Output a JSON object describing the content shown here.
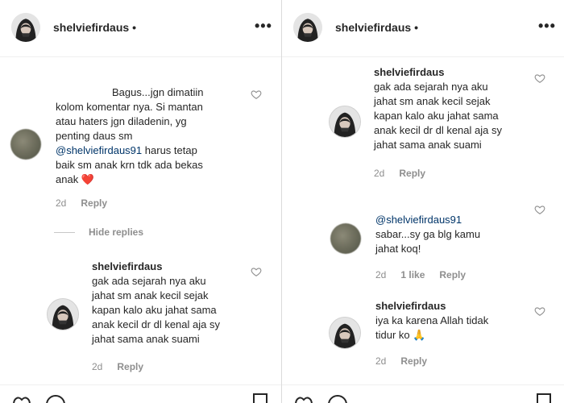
{
  "left": {
    "header": {
      "username": "shelviefirdaus",
      "separator": "•",
      "more": "•••"
    },
    "comment": {
      "lines": [
        "Bagus...jgn dimatiin",
        "kolom komentar nya. Si mantan",
        "atau haters jgn diladenin, yg",
        "penting daus sm",
        "harus tetap",
        "baik sm anak krn tdk ada bekas",
        "anak"
      ],
      "mention": "@shelviefirdaus91",
      "emoji": "❤️",
      "time": "2d",
      "reply": "Reply"
    },
    "hide_replies": "Hide replies",
    "reply_comment": {
      "username": "shelviefirdaus",
      "lines": [
        "gak ada sejarah nya aku",
        "jahat sm anak kecil sejak",
        "kapan kalo aku jahat sama",
        "anak kecil dr dl kenal aja sy",
        "jahat sama anak suami"
      ],
      "time": "2d",
      "reply": "Reply"
    }
  },
  "right": {
    "header": {
      "username": "shelviefirdaus",
      "separator": "•",
      "more": "•••"
    },
    "comment1": {
      "username": "shelviefirdaus",
      "lines": [
        "gak ada sejarah nya aku",
        "jahat sm anak kecil sejak",
        "kapan kalo aku jahat sama",
        "anak kecil dr dl kenal aja sy",
        "jahat sama anak suami"
      ],
      "time": "2d",
      "reply": "Reply"
    },
    "comment2": {
      "mention": "@shelviefirdaus91",
      "lines": [
        "sabar...sy ga blg kamu",
        "jahat koq!"
      ],
      "time": "2d",
      "likes": "1 like",
      "reply": "Reply"
    },
    "comment3": {
      "username": "shelviefirdaus",
      "lines": [
        "iya ka karena Allah tidak",
        "tidur ko"
      ],
      "emoji": "🙏",
      "time": "2d",
      "reply": "Reply"
    }
  }
}
